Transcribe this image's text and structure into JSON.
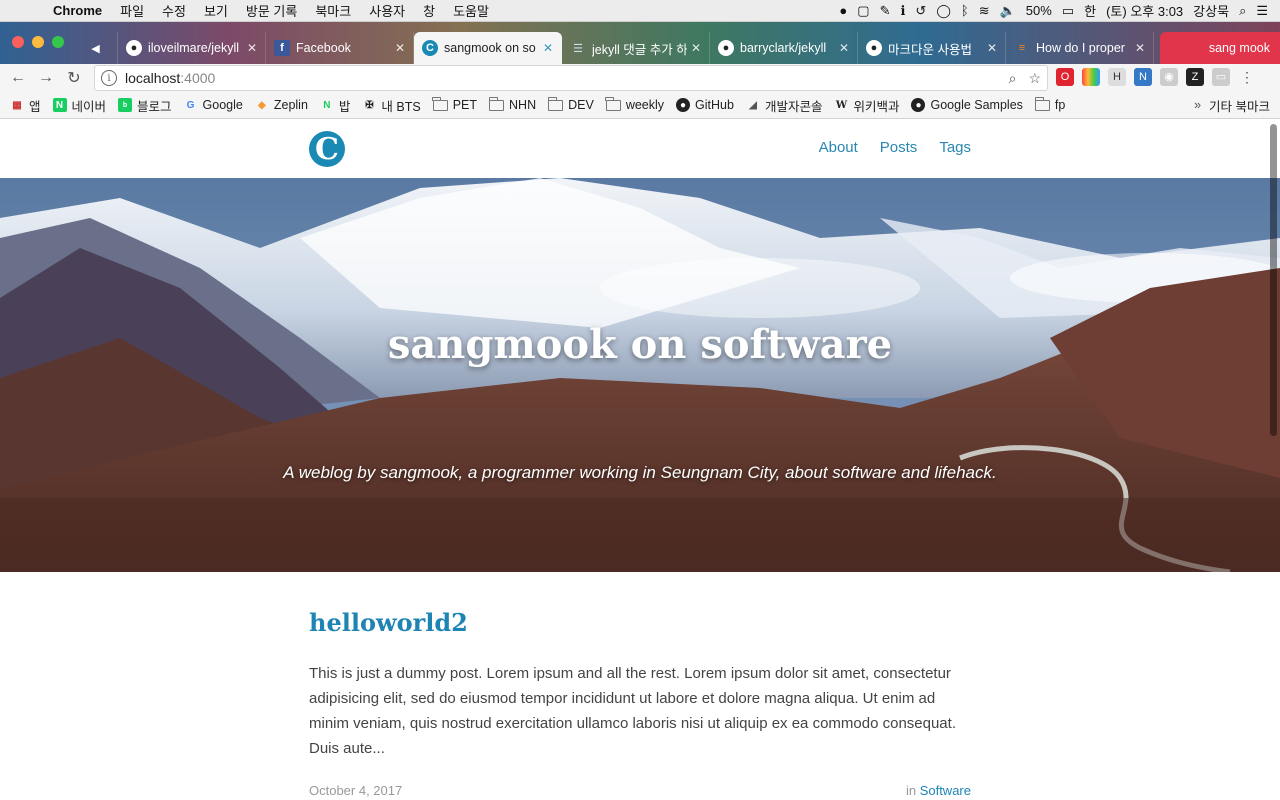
{
  "menubar": {
    "items": [
      "Chrome",
      "파일",
      "수정",
      "보기",
      "방문 기록",
      "북마크",
      "사용자",
      "창",
      "도움말"
    ],
    "battery": "50%",
    "input_source": "한",
    "clock": "(토) 오후 3:03",
    "user": "강상묵"
  },
  "tabs": [
    {
      "title": "",
      "icon": "speaker-icon",
      "mini": true
    },
    {
      "title": "iloveilmare/jekyll",
      "icon": "github-icon"
    },
    {
      "title": "Facebook",
      "icon": "facebook-icon"
    },
    {
      "title": "sangmook on so",
      "icon": "site-c-icon",
      "active": true
    },
    {
      "title": "jekyll 댓글 추가 하",
      "icon": "doc-icon"
    },
    {
      "title": "barryclark/jekyll",
      "icon": "github-icon"
    },
    {
      "title": "마크다운 사용법",
      "icon": "github-icon"
    },
    {
      "title": "How do I proper",
      "icon": "stackoverflow-icon"
    }
  ],
  "profile_name": "sang mook",
  "address": {
    "host": "localhost",
    "port": ":4000"
  },
  "bookmarks": [
    {
      "label": "앱",
      "icon": "apps-grid-icon"
    },
    {
      "label": "네이버",
      "icon": "naver-icon"
    },
    {
      "label": "블로그",
      "icon": "blog-icon"
    },
    {
      "label": "Google",
      "icon": "google-icon"
    },
    {
      "label": "Zeplin",
      "icon": "zeplin-icon"
    },
    {
      "label": "밥",
      "icon": "naver-icon"
    },
    {
      "label": "내 BTS",
      "icon": "bts-icon"
    },
    {
      "label": "PET",
      "icon": "folder-icon"
    },
    {
      "label": "NHN",
      "icon": "folder-icon"
    },
    {
      "label": "DEV",
      "icon": "folder-icon"
    },
    {
      "label": "weekly",
      "icon": "folder-icon"
    },
    {
      "label": "GitHub",
      "icon": "github-icon"
    },
    {
      "label": "개발자콘솔",
      "icon": "console-icon"
    },
    {
      "label": "위키백과",
      "icon": "wikipedia-icon"
    },
    {
      "label": "Google Samples",
      "icon": "github-icon"
    },
    {
      "label": "fp",
      "icon": "folder-icon"
    }
  ],
  "bookmarks_more": "»",
  "bookmarks_other": "기타 북마크",
  "site": {
    "logo_letter": "C",
    "nav": [
      "About",
      "Posts",
      "Tags"
    ],
    "title": "sangmook on software",
    "subtitle": "A weblog by sangmook, a programmer working in Seungnam City, about software and lifehack."
  },
  "post": {
    "title": "helloworld2",
    "excerpt": "This is just a dummy post. Lorem ipsum and all the rest. Lorem ipsum dolor sit amet, consectetur adipisicing elit, sed do eiusmod tempor incididunt ut labore et dolore magna aliqua. Ut enim ad minim veniam, quis nostrud exercitation ullamco laboris nisi ut aliquip ex ea commodo consequat. Duis aute...",
    "date": "October 4, 2017",
    "category_prefix": "in",
    "category": "Software"
  },
  "colors": {
    "accent": "#1d84b4",
    "nav_link": "#2a87b0",
    "logo": "#1a8ab5"
  }
}
